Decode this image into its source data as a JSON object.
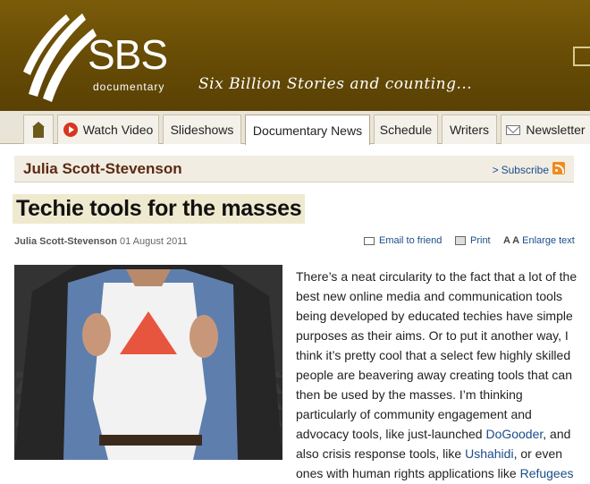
{
  "header": {
    "logo_text": "SBS",
    "logo_sub": "documentary",
    "tagline": "Six Billion Stories and counting..."
  },
  "nav": {
    "home_icon": "home-icon",
    "items": [
      {
        "label": "Watch Video",
        "icon": "play-icon"
      },
      {
        "label": "Slideshows"
      },
      {
        "label": "Documentary News",
        "active": true
      },
      {
        "label": "Schedule"
      },
      {
        "label": "Writers"
      },
      {
        "label": "Newsletter",
        "icon": "mail-icon"
      }
    ]
  },
  "author_bar": {
    "name": "Julia Scott-Stevenson",
    "subscribe": "Subscribe",
    "subscribe_prefix": ">"
  },
  "article": {
    "title": "Techie tools for the masses",
    "author": "Julia Scott-Stevenson",
    "date": "01 August 2011",
    "actions": {
      "email": "Email to friend",
      "print": "Print",
      "enlarge_prefix": "A A",
      "enlarge": "Enlarge text"
    },
    "body_before": "There’s a neat circularity to the fact that a lot of the best new online media and communication tools being developed by educated techies have simple purposes as their aims. Or to put it another way, I think it’s pretty cool that a select few highly skilled people are beavering away creating tools that can then be used by the masses. I’m thinking particularly of community engagement and advocacy tools, like just-launched ",
    "link1": "DoGooder",
    "body_mid1": ", and also crisis response tools, like ",
    "link2": "Ushahidi",
    "body_mid2": ", or even ones with human rights applications like ",
    "link3": "Refugees"
  },
  "colors": {
    "header_bg": "#6b4f06",
    "author_color": "#5c2a12",
    "link": "#1a4c8a",
    "title_highlight": "#efe9cf",
    "triangle": "#e8553f"
  }
}
